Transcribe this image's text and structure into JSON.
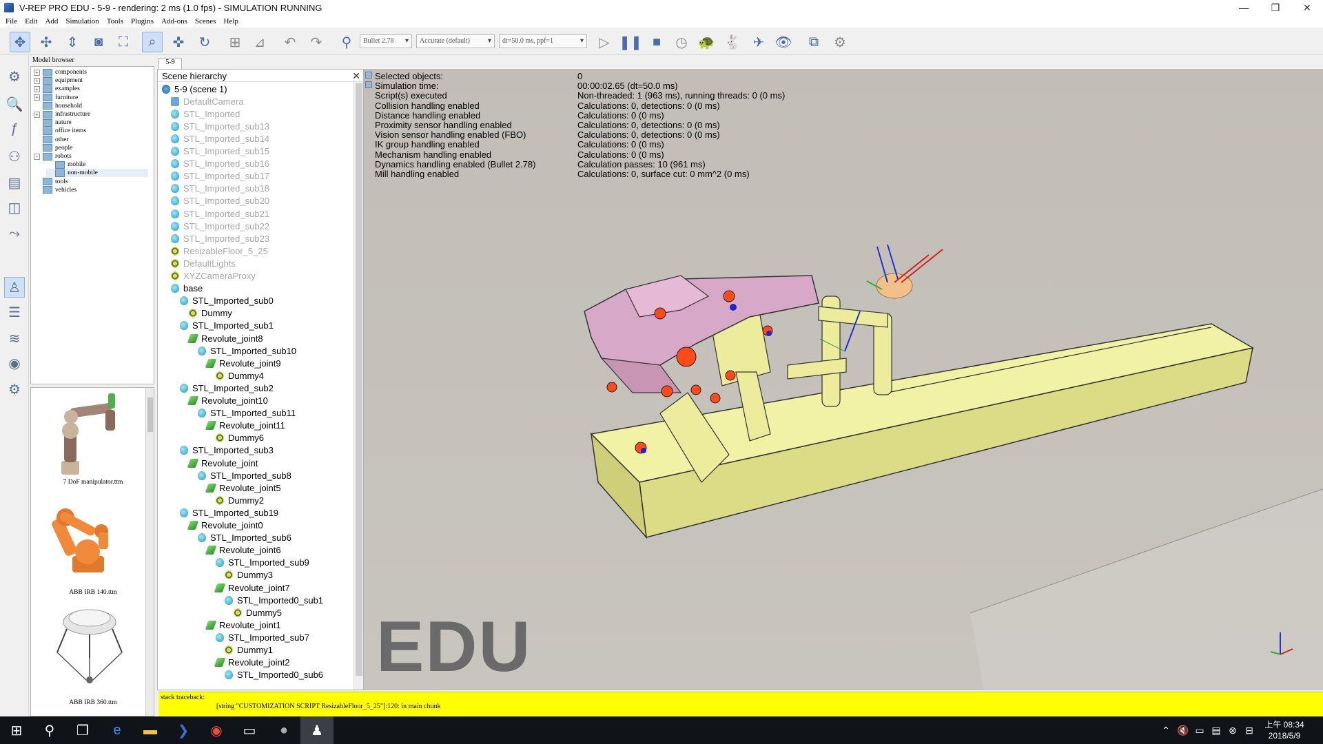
{
  "window": {
    "title": "V-REP PRO EDU - 5-9 - rendering: 2 ms (1.0 fps) - SIMULATION RUNNING",
    "minimize": "—",
    "restore": "❐",
    "close": "✕"
  },
  "menu": [
    "File",
    "Edit",
    "Add",
    "Simulation",
    "Tools",
    "Plugins",
    "Add-ons",
    "Scenes",
    "Help"
  ],
  "toolbar": {
    "engine": "Bullet 2.78",
    "accuracy": "Accurate (default)",
    "timestep": "dt=50.0 ms, ppf=1"
  },
  "model_browser": {
    "header": "Model browser",
    "items": [
      {
        "label": "components",
        "expand": "+",
        "selected": false
      },
      {
        "label": "equipment",
        "expand": "+",
        "selected": false
      },
      {
        "label": "examples",
        "expand": "+",
        "selected": false
      },
      {
        "label": "furniture",
        "expand": "+",
        "selected": false
      },
      {
        "label": "household",
        "expand": "",
        "selected": false
      },
      {
        "label": "infrastructure",
        "expand": "+",
        "selected": false
      },
      {
        "label": "nature",
        "expand": "",
        "selected": false
      },
      {
        "label": "office items",
        "expand": "",
        "selected": false
      },
      {
        "label": "other",
        "expand": "",
        "selected": false
      },
      {
        "label": "people",
        "expand": "",
        "selected": false
      },
      {
        "label": "robots",
        "expand": "−",
        "selected": false
      },
      {
        "label": "mobile",
        "expand": "",
        "selected": false
      },
      {
        "label": "non-mobile",
        "expand": "",
        "selected": true
      },
      {
        "label": "tools",
        "expand": "",
        "selected": false
      },
      {
        "label": "vehicles",
        "expand": "",
        "selected": false
      }
    ],
    "thumbnails": [
      "7 DoF manipulator.ttm",
      "ABB IRB 140.ttm",
      "ABB IRB 360.ttm"
    ]
  },
  "scene_tab": "5-9",
  "scene_hierarchy": {
    "header": "Scene hierarchy",
    "close_label": "✕",
    "rows": [
      {
        "label": "5-9 (scene 1)",
        "icon": "scene",
        "dim": false
      },
      {
        "label": "DefaultCamera",
        "icon": "cam",
        "dim": true
      },
      {
        "label": "STL_Imported",
        "icon": "shape",
        "dim": true
      },
      {
        "label": "STL_Imported_sub13",
        "icon": "shape",
        "dim": true
      },
      {
        "label": "STL_Imported_sub14",
        "icon": "shape",
        "dim": true
      },
      {
        "label": "STL_Imported_sub15",
        "icon": "shape",
        "dim": true
      },
      {
        "label": "STL_Imported_sub16",
        "icon": "shape",
        "dim": true
      },
      {
        "label": "STL_Imported_sub17",
        "icon": "shape",
        "dim": true
      },
      {
        "label": "STL_Imported_sub18",
        "icon": "shape",
        "dim": true
      },
      {
        "label": "STL_Imported_sub20",
        "icon": "shape",
        "dim": true
      },
      {
        "label": "STL_Imported_sub21",
        "icon": "shape",
        "dim": true
      },
      {
        "label": "STL_Imported_sub22",
        "icon": "shape",
        "dim": true
      },
      {
        "label": "STL_Imported_sub23",
        "icon": "shape",
        "dim": true
      },
      {
        "label": "ResizableFloor_5_25",
        "icon": "dummy",
        "dim": true
      },
      {
        "label": "DefaultLights",
        "icon": "dummy",
        "dim": true
      },
      {
        "label": "XYZCameraProxy",
        "icon": "dummy",
        "dim": true
      },
      {
        "label": "base",
        "icon": "shape",
        "dim": false
      },
      {
        "label": "STL_Imported_sub0",
        "icon": "shape",
        "dim": false
      },
      {
        "label": "Dummy",
        "icon": "dummy",
        "dim": false
      },
      {
        "label": "STL_Imported_sub1",
        "icon": "shape",
        "dim": false
      },
      {
        "label": "Revolute_joint8",
        "icon": "joint",
        "dim": false
      },
      {
        "label": "STL_Imported_sub10",
        "icon": "shape",
        "dim": false
      },
      {
        "label": "Revolute_joint9",
        "icon": "joint",
        "dim": false
      },
      {
        "label": "Dummy4",
        "icon": "dummy",
        "dim": false
      },
      {
        "label": "STL_Imported_sub2",
        "icon": "shape",
        "dim": false
      },
      {
        "label": "Revolute_joint10",
        "icon": "joint",
        "dim": false
      },
      {
        "label": "STL_Imported_sub11",
        "icon": "shape",
        "dim": false
      },
      {
        "label": "Revolute_joint11",
        "icon": "joint",
        "dim": false
      },
      {
        "label": "Dummy6",
        "icon": "dummy",
        "dim": false
      },
      {
        "label": "STL_Imported_sub3",
        "icon": "shape",
        "dim": false
      },
      {
        "label": "Revolute_joint",
        "icon": "joint",
        "dim": false
      },
      {
        "label": "STL_Imported_sub8",
        "icon": "shape",
        "dim": false
      },
      {
        "label": "Revolute_joint5",
        "icon": "joint",
        "dim": false
      },
      {
        "label": "Dummy2",
        "icon": "dummy",
        "dim": false
      },
      {
        "label": "STL_Imported_sub19",
        "icon": "shape",
        "dim": false
      },
      {
        "label": "Revolute_joint0",
        "icon": "joint",
        "dim": false
      },
      {
        "label": "STL_Imported_sub6",
        "icon": "shape",
        "dim": false
      },
      {
        "label": "Revolute_joint6",
        "icon": "joint",
        "dim": false
      },
      {
        "label": "STL_Imported_sub9",
        "icon": "shape",
        "dim": false
      },
      {
        "label": "Dummy3",
        "icon": "dummy",
        "dim": false
      },
      {
        "label": "Revolute_joint7",
        "icon": "joint",
        "dim": false
      },
      {
        "label": "STL_Imported0_sub1",
        "icon": "shape",
        "dim": false
      },
      {
        "label": "Dummy5",
        "icon": "dummy",
        "dim": false
      },
      {
        "label": "Revolute_joint1",
        "icon": "joint",
        "dim": false
      },
      {
        "label": "STL_Imported_sub7",
        "icon": "shape",
        "dim": false
      },
      {
        "label": "Dummy1",
        "icon": "dummy",
        "dim": false
      },
      {
        "label": "Revolute_joint2",
        "icon": "joint",
        "dim": false
      },
      {
        "label": "STL_Imported0_sub6",
        "icon": "shape",
        "dim": false
      }
    ]
  },
  "sim_info": {
    "labels": [
      "Selected objects:",
      "Simulation time:",
      "Script(s) executed",
      "Collision handling enabled",
      "Distance handling enabled",
      "Proximity sensor handling enabled",
      "Vision sensor handling enabled (FBO)",
      "IK group handling enabled",
      "Mechanism handling enabled",
      "Dynamics handling enabled (Bullet 2.78)",
      "Mill handling enabled"
    ],
    "values": [
      "0",
      "00:00:02.65 (dt=50.0 ms)",
      "Non-threaded: 1 (963 ms), running threads: 0 (0 ms)",
      "Calculations: 0, detections: 0 (0 ms)",
      "Calculations: 0 (0 ms)",
      "Calculations: 0, detections: 0 (0 ms)",
      "Calculations: 0, detections: 0 (0 ms)",
      "Calculations: 0 (0 ms)",
      "Calculations: 0 (0 ms)",
      "Calculation passes: 10 (961 ms)",
      "Calculations: 0, surface cut: 0 mm^2 (0 ms)"
    ]
  },
  "viewport": {
    "watermark": "EDU"
  },
  "console": {
    "line1": "stack traceback:",
    "line2": "[string \"CUSTOMIZATION SCRIPT ResizableFloor_5_25\"]:120: in main chunk"
  },
  "taskbar": {
    "time": "上午 08:34",
    "date": "2018/5/9"
  },
  "colors": {
    "console_bg": "#ffff00",
    "viewport_floor": "#c5c1bb",
    "base_block": "#e8e89a",
    "arm_pink": "#d8a8c8"
  }
}
